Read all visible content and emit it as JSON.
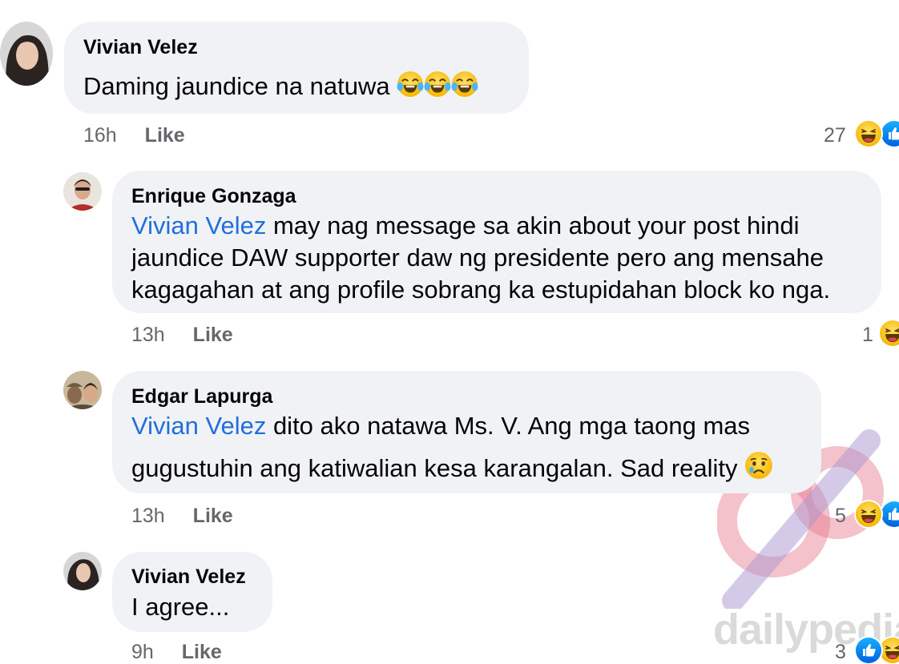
{
  "comments": [
    {
      "author": "Vivian Velez",
      "text": "Daming jaundice na natuwa",
      "time": "16h",
      "like_label": "Like",
      "reaction_count": "27",
      "reactions": [
        "haha-icon",
        "like-icon"
      ]
    },
    {
      "author": "Enrique Gonzaga",
      "mention": "Vivian Velez",
      "line1": " may nag message sa akin about your post hindi",
      "line2": "jaundice DAW supporter daw ng presidente pero ang mensahe",
      "line3": "kagagahan at ang profile sobrang ka estupidahan block ko nga.",
      "time": "13h",
      "like_label": "Like",
      "reaction_count": "1",
      "reactions": [
        "haha-icon"
      ]
    },
    {
      "author": "Edgar Lapurga",
      "mention": "Vivian Velez",
      "line1": " dito ako natawa Ms. V. Ang mga taong mas",
      "line2": "gugustuhin ang katiwalian kesa karangalan. Sad reality",
      "time": "13h",
      "like_label": "Like",
      "reaction_count": "5",
      "reactions": [
        "haha-icon",
        "like-icon"
      ]
    },
    {
      "author": "Vivian Velez",
      "text": "I agree...",
      "time": "9h",
      "like_label": "Like",
      "reaction_count": "3",
      "reactions": [
        "like-icon",
        "haha-icon"
      ]
    }
  ],
  "watermark": {
    "text": "dailypedia"
  },
  "colors": {
    "bubble": "#f0f2f5",
    "mention": "#216fdb",
    "meta": "#65676b",
    "like_blue": "#1877f2",
    "haha_yellow": "#f7b125"
  }
}
